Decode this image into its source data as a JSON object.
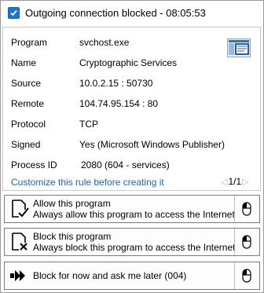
{
  "title": "Outgoing connection blocked - 08:05:53",
  "details": [
    {
      "label": "Program",
      "value": "svchost.exe"
    },
    {
      "label": "Name",
      "value": "Cryptographic Services"
    },
    {
      "label": "Source",
      "value": "10.0.2.15 : 50730"
    },
    {
      "label": "Remote",
      "value": "104.74.95.154 : 80"
    },
    {
      "label": "Protocol",
      "value": "TCP"
    },
    {
      "label": "Signed",
      "value": "Yes (Microsoft Windows Publisher)"
    },
    {
      "label": "Process ID",
      "value": "2080 (604 - services)"
    }
  ],
  "customize_link": "Customize this rule before creating it",
  "pager": {
    "text": "1/1"
  },
  "actions": {
    "allow": {
      "title": "Allow this program",
      "subtitle": "Always allow this program to access the Internet"
    },
    "block": {
      "title": "Block this program",
      "subtitle": "Always block this program to access the Internet"
    },
    "later": {
      "title": "Block for now and ask me later (004)"
    }
  },
  "colors": {
    "accent": "#1a73d6",
    "link": "#1a64c8"
  }
}
